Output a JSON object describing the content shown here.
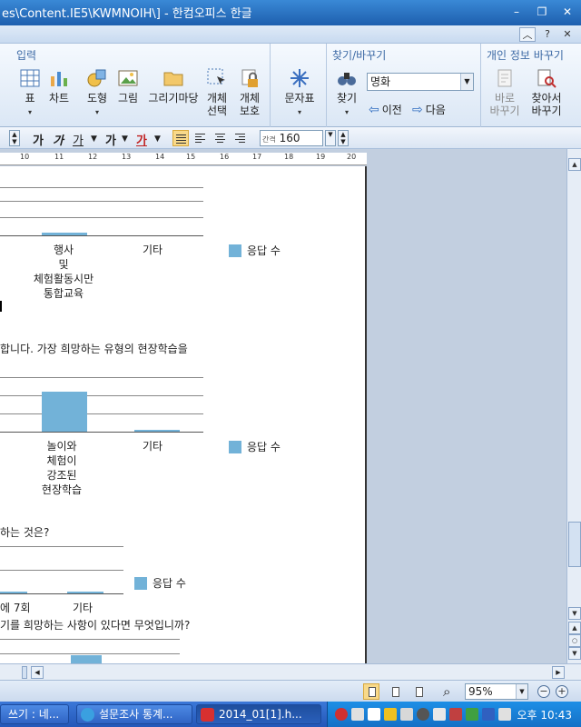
{
  "window": {
    "title": "es\\Content.IE5\\KWMNOIH\\] - 한컴오피스 한글"
  },
  "ribbon": {
    "groups": {
      "insert": {
        "title": "입력",
        "buttons": [
          "표",
          "차트",
          "도형",
          "그림",
          "그리기마당",
          "개체\n선택",
          "개체\n보호"
        ]
      },
      "chars": {
        "button": "문자표"
      },
      "find": {
        "title": "찾기/바꾸기",
        "button": "찾기",
        "field_value": "명화",
        "prev_label": "이전",
        "next_label": "다음"
      },
      "privacy": {
        "title": "개인 정보 바꾸기",
        "btn_change": "바로\n바꾸기",
        "btn_find_change": "찾아서\n바꾸기"
      }
    }
  },
  "format": {
    "bold_ga": "가",
    "italic_ga": "가",
    "underline_ga": "가",
    "font_ga": "가",
    "color_ga": "가",
    "line_spacing_label": "간격",
    "zoom_value": "160",
    "zoom_unit": "%"
  },
  "ruler": {
    "ticks": [
      "10",
      "11",
      "12",
      "13",
      "14",
      "15",
      "16",
      "17",
      "18",
      "19",
      "20"
    ]
  },
  "document": {
    "chart1": {
      "cat1": "행사\n및\n체험활동시만\n통합교육",
      "cat2": "기타",
      "legend": "응답 수"
    },
    "question2_tail": "합니다. 가장 희망하는 유형의 현장학습을",
    "chart2": {
      "cat1": "놀이와\n체험이\n강조된\n현장학습",
      "cat2": "기타",
      "legend": "응답 수"
    },
    "question3_tail": "하는 것은?",
    "chart3": {
      "cat1": "에 7회",
      "cat2": "기타",
      "legend": "응답 수"
    },
    "question4_tail": "기를 희망하는 사항이 있다면 무엇입니까?"
  },
  "status": {
    "zoom": "95%"
  },
  "taskbar": {
    "tasks": [
      "쓰기 : 네...",
      "설문조사 통계...",
      "2014_01[1].h..."
    ],
    "clock": "오후 10:43"
  },
  "chart_data": [
    {
      "type": "bar",
      "categories": [
        "행사 및 체험활동시만 통합교육",
        "기타"
      ],
      "series": [
        {
          "name": "응답 수",
          "values": [
            1,
            0
          ]
        }
      ]
    },
    {
      "type": "bar",
      "categories": [
        "놀이와 체험이 강조된 현장학습",
        "기타"
      ],
      "series": [
        {
          "name": "응답 수",
          "values": [
            22,
            1
          ]
        }
      ]
    }
  ]
}
